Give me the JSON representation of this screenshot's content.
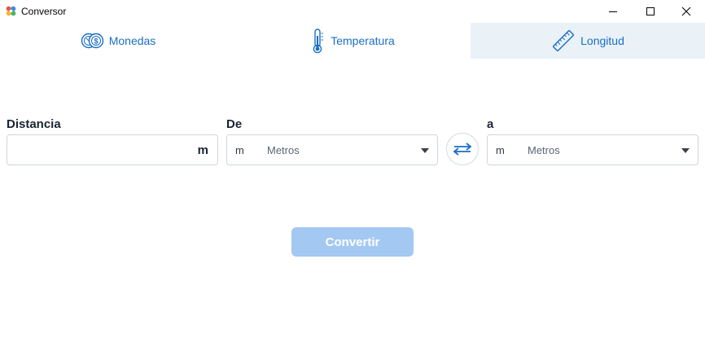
{
  "window": {
    "title": "Conversor"
  },
  "tabs": [
    {
      "label": "Monedas",
      "icon": "coins-icon"
    },
    {
      "label": "Temperatura",
      "icon": "thermometer-icon"
    },
    {
      "label": "Longitud",
      "icon": "ruler-icon",
      "selected": true
    }
  ],
  "form": {
    "distance_label": "Distancia",
    "distance_value": "",
    "distance_unit": "m",
    "from_label": "De",
    "from_unit_abbr": "m",
    "from_unit_name": "Metros",
    "to_label": "a",
    "to_unit_abbr": "m",
    "to_unit_name": "Metros"
  },
  "actions": {
    "convert_label": "Convertir"
  },
  "colors": {
    "accent": "#1a6fc4",
    "selected_tab_bg": "#eaf1f7",
    "convert_disabled_bg": "#a3c8f2"
  }
}
